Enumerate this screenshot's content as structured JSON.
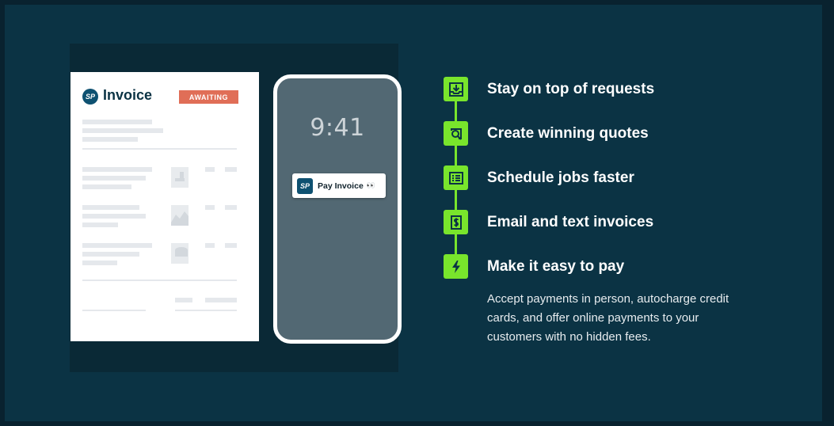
{
  "invoice": {
    "logo_text": "SP",
    "title": "Invoice",
    "status_badge": "AWAITING"
  },
  "phone": {
    "time": "9:41",
    "notification": {
      "logo_text": "SP",
      "label": "Pay Invoice",
      "emoji": "👀"
    }
  },
  "features": {
    "items": [
      {
        "label": "Stay on top of requests",
        "icon": "inbox-download-icon"
      },
      {
        "label": "Create winning quotes",
        "icon": "magnifier-quote-icon"
      },
      {
        "label": "Schedule jobs faster",
        "icon": "list-schedule-icon"
      },
      {
        "label": "Email and text invoices",
        "icon": "invoice-dollar-icon"
      },
      {
        "label": "Make it easy to pay",
        "icon": "lightning-bolt-icon"
      }
    ],
    "description": "Accept payments in person, autocharge credit cards, and offer online payments to your customers with no hidden fees."
  },
  "colors": {
    "background": "#0b3344",
    "accent_green": "#79e52c",
    "badge_red": "#e06e57",
    "brand_blue": "#0e5171"
  }
}
